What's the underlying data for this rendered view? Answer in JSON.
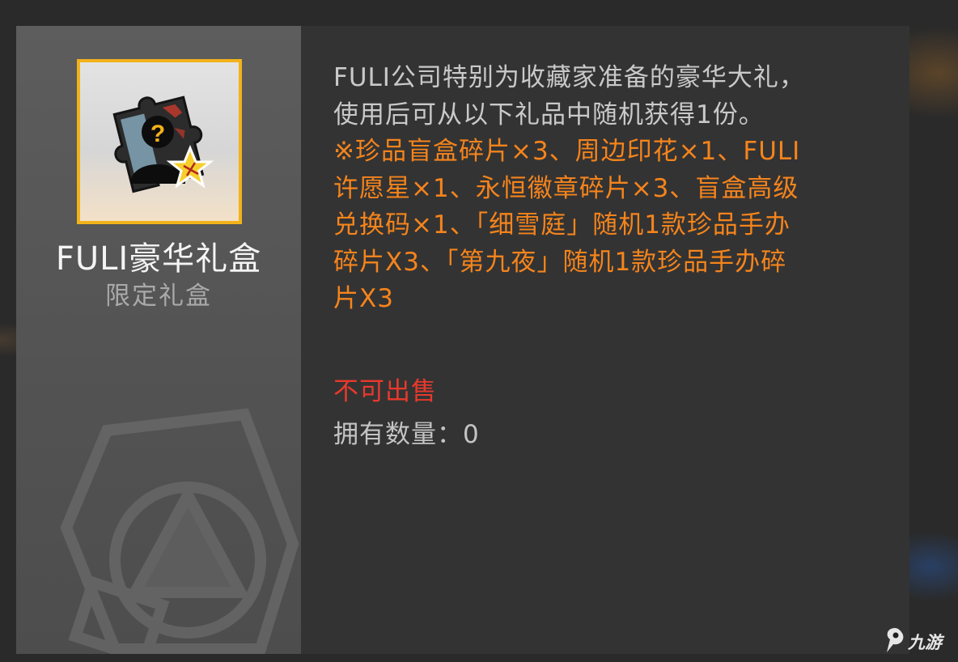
{
  "item": {
    "name": "FULI豪华礼盒",
    "type": "限定礼盒",
    "icon": "mystery-puzzle-icon"
  },
  "description": {
    "intro_line1": "FULI公司特别为收藏家准备的豪华大礼，",
    "intro_line2": "使用后可从以下礼品中随机获得1份。",
    "rewards_lines": [
      "※珍品盲盒碎片×3、周边印花×1、FULI",
      "许愿星×1、永恒徽章碎片×3、盲盒高级",
      "兑换码×1、「细雪庭」随机1款珍品手办",
      "碎片X3、「第九夜」随机1款珍品手办碎",
      "片X3"
    ]
  },
  "status": {
    "sellable": "不可出售",
    "owned_label": "拥有数量：0"
  },
  "watermark": {
    "text": "九游",
    "icon": "jiuyou-logo-icon"
  },
  "colors": {
    "frame": "#f2b21a",
    "reward_text": "#f5841c",
    "warning_text": "#e8392c",
    "panel": "#333333"
  }
}
